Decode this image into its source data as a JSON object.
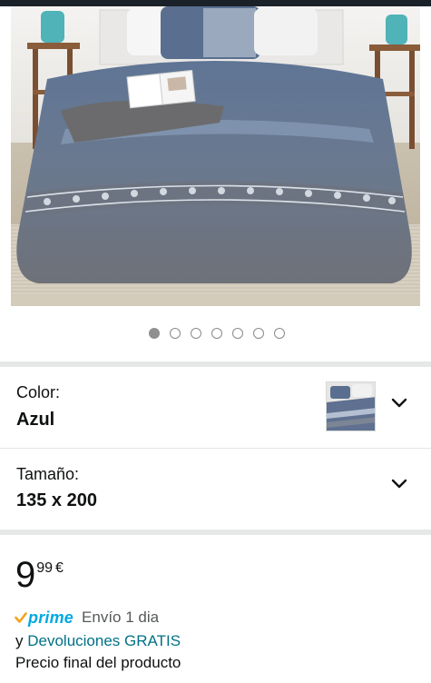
{
  "carousel": {
    "total": 7,
    "active_index": 0
  },
  "color_selector": {
    "label": "Color:",
    "value": "Azul",
    "swatch_icon": "bedding-swatch-thumbnail",
    "chevron_icon": "chevron-down-icon"
  },
  "size_selector": {
    "label": "Tamaño:",
    "value": "135 x 200",
    "chevron_icon": "chevron-down-icon"
  },
  "price": {
    "whole": "9",
    "fraction": "99",
    "currency": "€"
  },
  "prime": {
    "logo_text": "prime",
    "shipping": "Envío 1 dia",
    "returns_prefix": "y",
    "returns_link": "Devoluciones GRATIS",
    "final_price_note": "Precio final del producto"
  },
  "colors": {
    "prime_blue": "#00a8e1",
    "prime_check": "#f0a41e",
    "link": "#007185",
    "text": "#0f1111",
    "muted": "#565959",
    "duvet": "#5c6b83"
  }
}
